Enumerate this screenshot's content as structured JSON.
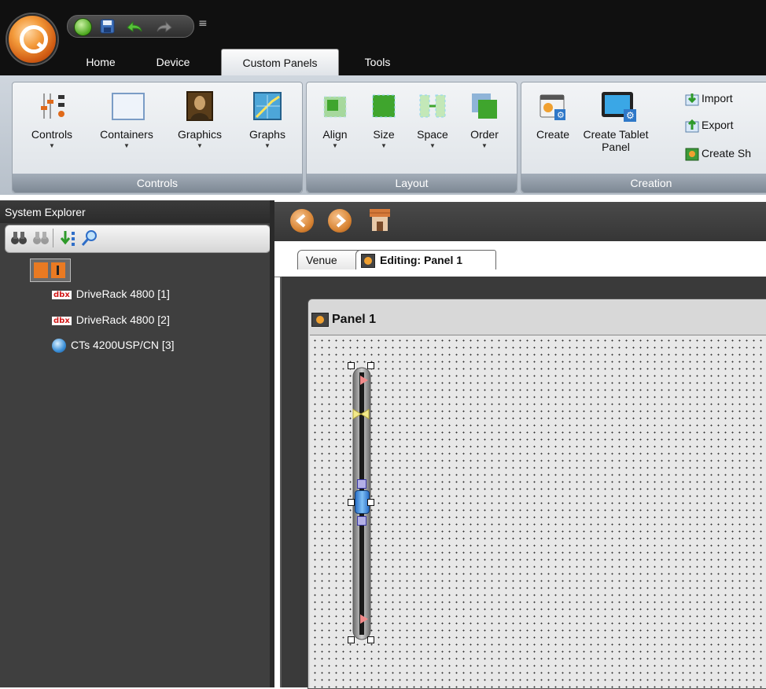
{
  "ribbon_tabs": {
    "home": "Home",
    "device": "Device",
    "custom_panels": "Custom Panels",
    "tools": "Tools"
  },
  "groups": {
    "controls": {
      "title": "Controls",
      "buttons": [
        "Controls",
        "Containers",
        "Graphics",
        "Graphs"
      ]
    },
    "layout": {
      "title": "Layout",
      "buttons": [
        "Align",
        "Size",
        "Space",
        "Order"
      ]
    },
    "creation": {
      "title": "Creation",
      "create": "Create",
      "create_tablet": [
        "Create Tablet",
        "Panel"
      ],
      "import": "Import",
      "export": "Export",
      "create_sh": "Create Sh"
    }
  },
  "explorer": {
    "title": "System Explorer",
    "items": [
      {
        "badge": "dbx",
        "label": "DriveRack 4800 [1]"
      },
      {
        "badge": "dbx",
        "label": "DriveRack 4800 [2]"
      },
      {
        "label": "CTs 4200USP/CN [3]"
      }
    ]
  },
  "doc_tabs": {
    "venue": "Venue",
    "editing": "Editing: Panel 1"
  },
  "panel": {
    "title": "Panel 1"
  },
  "colors": {
    "accent_orange": "#e07a2a",
    "ribbon_bg": "#c6ced7",
    "dark_bg": "#3f3f3f"
  }
}
